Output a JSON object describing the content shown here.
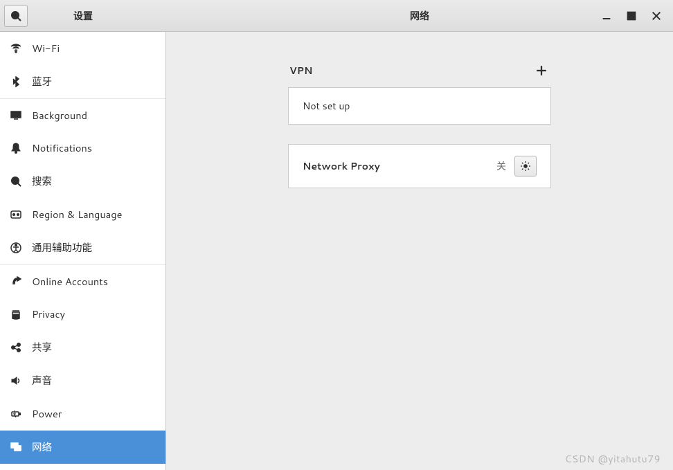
{
  "header": {
    "app_title": "设置",
    "page_title": "网络"
  },
  "sidebar": {
    "items": [
      {
        "icon": "wifi",
        "label": "Wi-Fi"
      },
      {
        "icon": "bluetooth",
        "label": "蓝牙"
      },
      {
        "icon": "background",
        "label": "Background"
      },
      {
        "icon": "notifications",
        "label": "Notifications"
      },
      {
        "icon": "search",
        "label": "搜索"
      },
      {
        "icon": "region",
        "label": "Region & Language"
      },
      {
        "icon": "accessibility",
        "label": "通用辅助功能"
      },
      {
        "icon": "online",
        "label": "Online Accounts"
      },
      {
        "icon": "privacy",
        "label": "Privacy"
      },
      {
        "icon": "sharing",
        "label": "共享"
      },
      {
        "icon": "sound",
        "label": "声音"
      },
      {
        "icon": "power",
        "label": "Power"
      },
      {
        "icon": "network",
        "label": "网络"
      }
    ]
  },
  "vpn": {
    "title": "VPN",
    "status": "Not set up"
  },
  "proxy": {
    "title": "Network Proxy",
    "state": "关"
  },
  "watermark": "CSDN @yitahutu79"
}
